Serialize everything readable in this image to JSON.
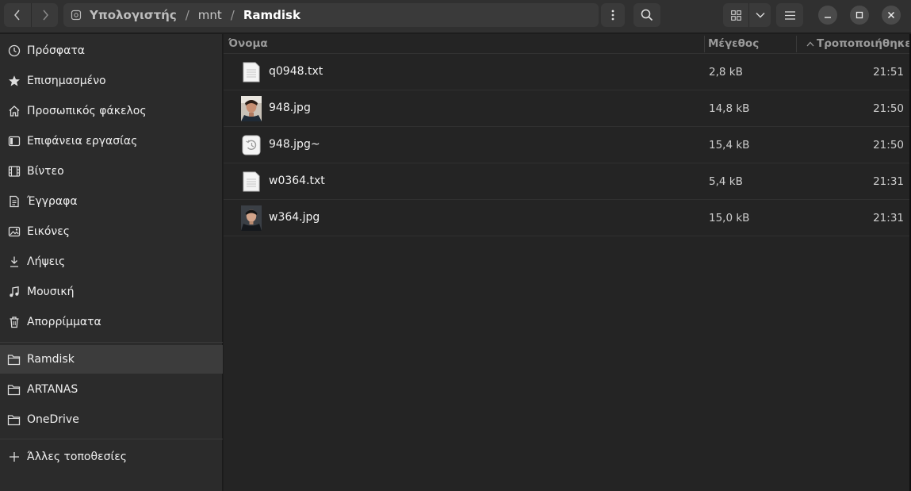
{
  "path": {
    "crumbs": [
      "Υπολογιστής",
      "mnt",
      "Ramdisk"
    ],
    "separator": "/"
  },
  "toolbar": {
    "back_icon": "chevron-left-icon",
    "forward_icon": "chevron-right-icon",
    "menu_icon": "vertical-dots-icon",
    "search_icon": "search-icon",
    "view_icon": "grid-icon",
    "hamburger_icon": "hamburger-icon"
  },
  "window_controls": [
    "minimize-icon",
    "maximize-icon",
    "close-icon"
  ],
  "sidebar": {
    "places": [
      {
        "label": "Πρόσφατα",
        "icon": "clock-icon"
      },
      {
        "label": "Επισημασμένο",
        "icon": "star-icon"
      },
      {
        "label": "Προσωπικός φάκελος",
        "icon": "home-icon"
      },
      {
        "label": "Επιφάνεια εργασίας",
        "icon": "desktop-icon"
      },
      {
        "label": "Βίντεο",
        "icon": "film-icon"
      },
      {
        "label": "Έγγραφα",
        "icon": "document-icon"
      },
      {
        "label": "Εικόνες",
        "icon": "picture-icon"
      },
      {
        "label": "Λήψεις",
        "icon": "download-icon"
      },
      {
        "label": "Μουσική",
        "icon": "music-icon"
      },
      {
        "label": "Απορρίμματα",
        "icon": "trash-icon"
      }
    ],
    "bookmarks": [
      {
        "label": "Ramdisk",
        "icon": "folder-icon",
        "active": true
      },
      {
        "label": "ARTANAS",
        "icon": "folder-icon"
      },
      {
        "label": "OneDrive",
        "icon": "folder-icon"
      }
    ],
    "other_locations": {
      "label": "Άλλες τοποθεσίες",
      "icon": "plus-icon"
    }
  },
  "columns": {
    "name": "Όνομα",
    "size": "Μέγεθος",
    "modified": "Τροποποιήθηκε"
  },
  "files": [
    {
      "name": "q0948.txt",
      "size": "2,8 kB",
      "modified": "21:51",
      "icon": "text-file-icon"
    },
    {
      "name": "948.jpg",
      "size": "14,8 kB",
      "modified": "21:50",
      "icon": "image-thumbnail-icon"
    },
    {
      "name": "948.jpg~",
      "size": "15,4 kB",
      "modified": "21:50",
      "icon": "backup-file-icon"
    },
    {
      "name": "w0364.txt",
      "size": "5,4 kB",
      "modified": "21:31",
      "icon": "text-file-icon"
    },
    {
      "name": "w364.jpg",
      "size": "15,0 kB",
      "modified": "21:31",
      "icon": "image-thumbnail-icon"
    }
  ],
  "colors": {
    "background": "#242424",
    "sidebar": "#2b2b2b",
    "header": "#303030",
    "selected": "#3c3c3c"
  }
}
